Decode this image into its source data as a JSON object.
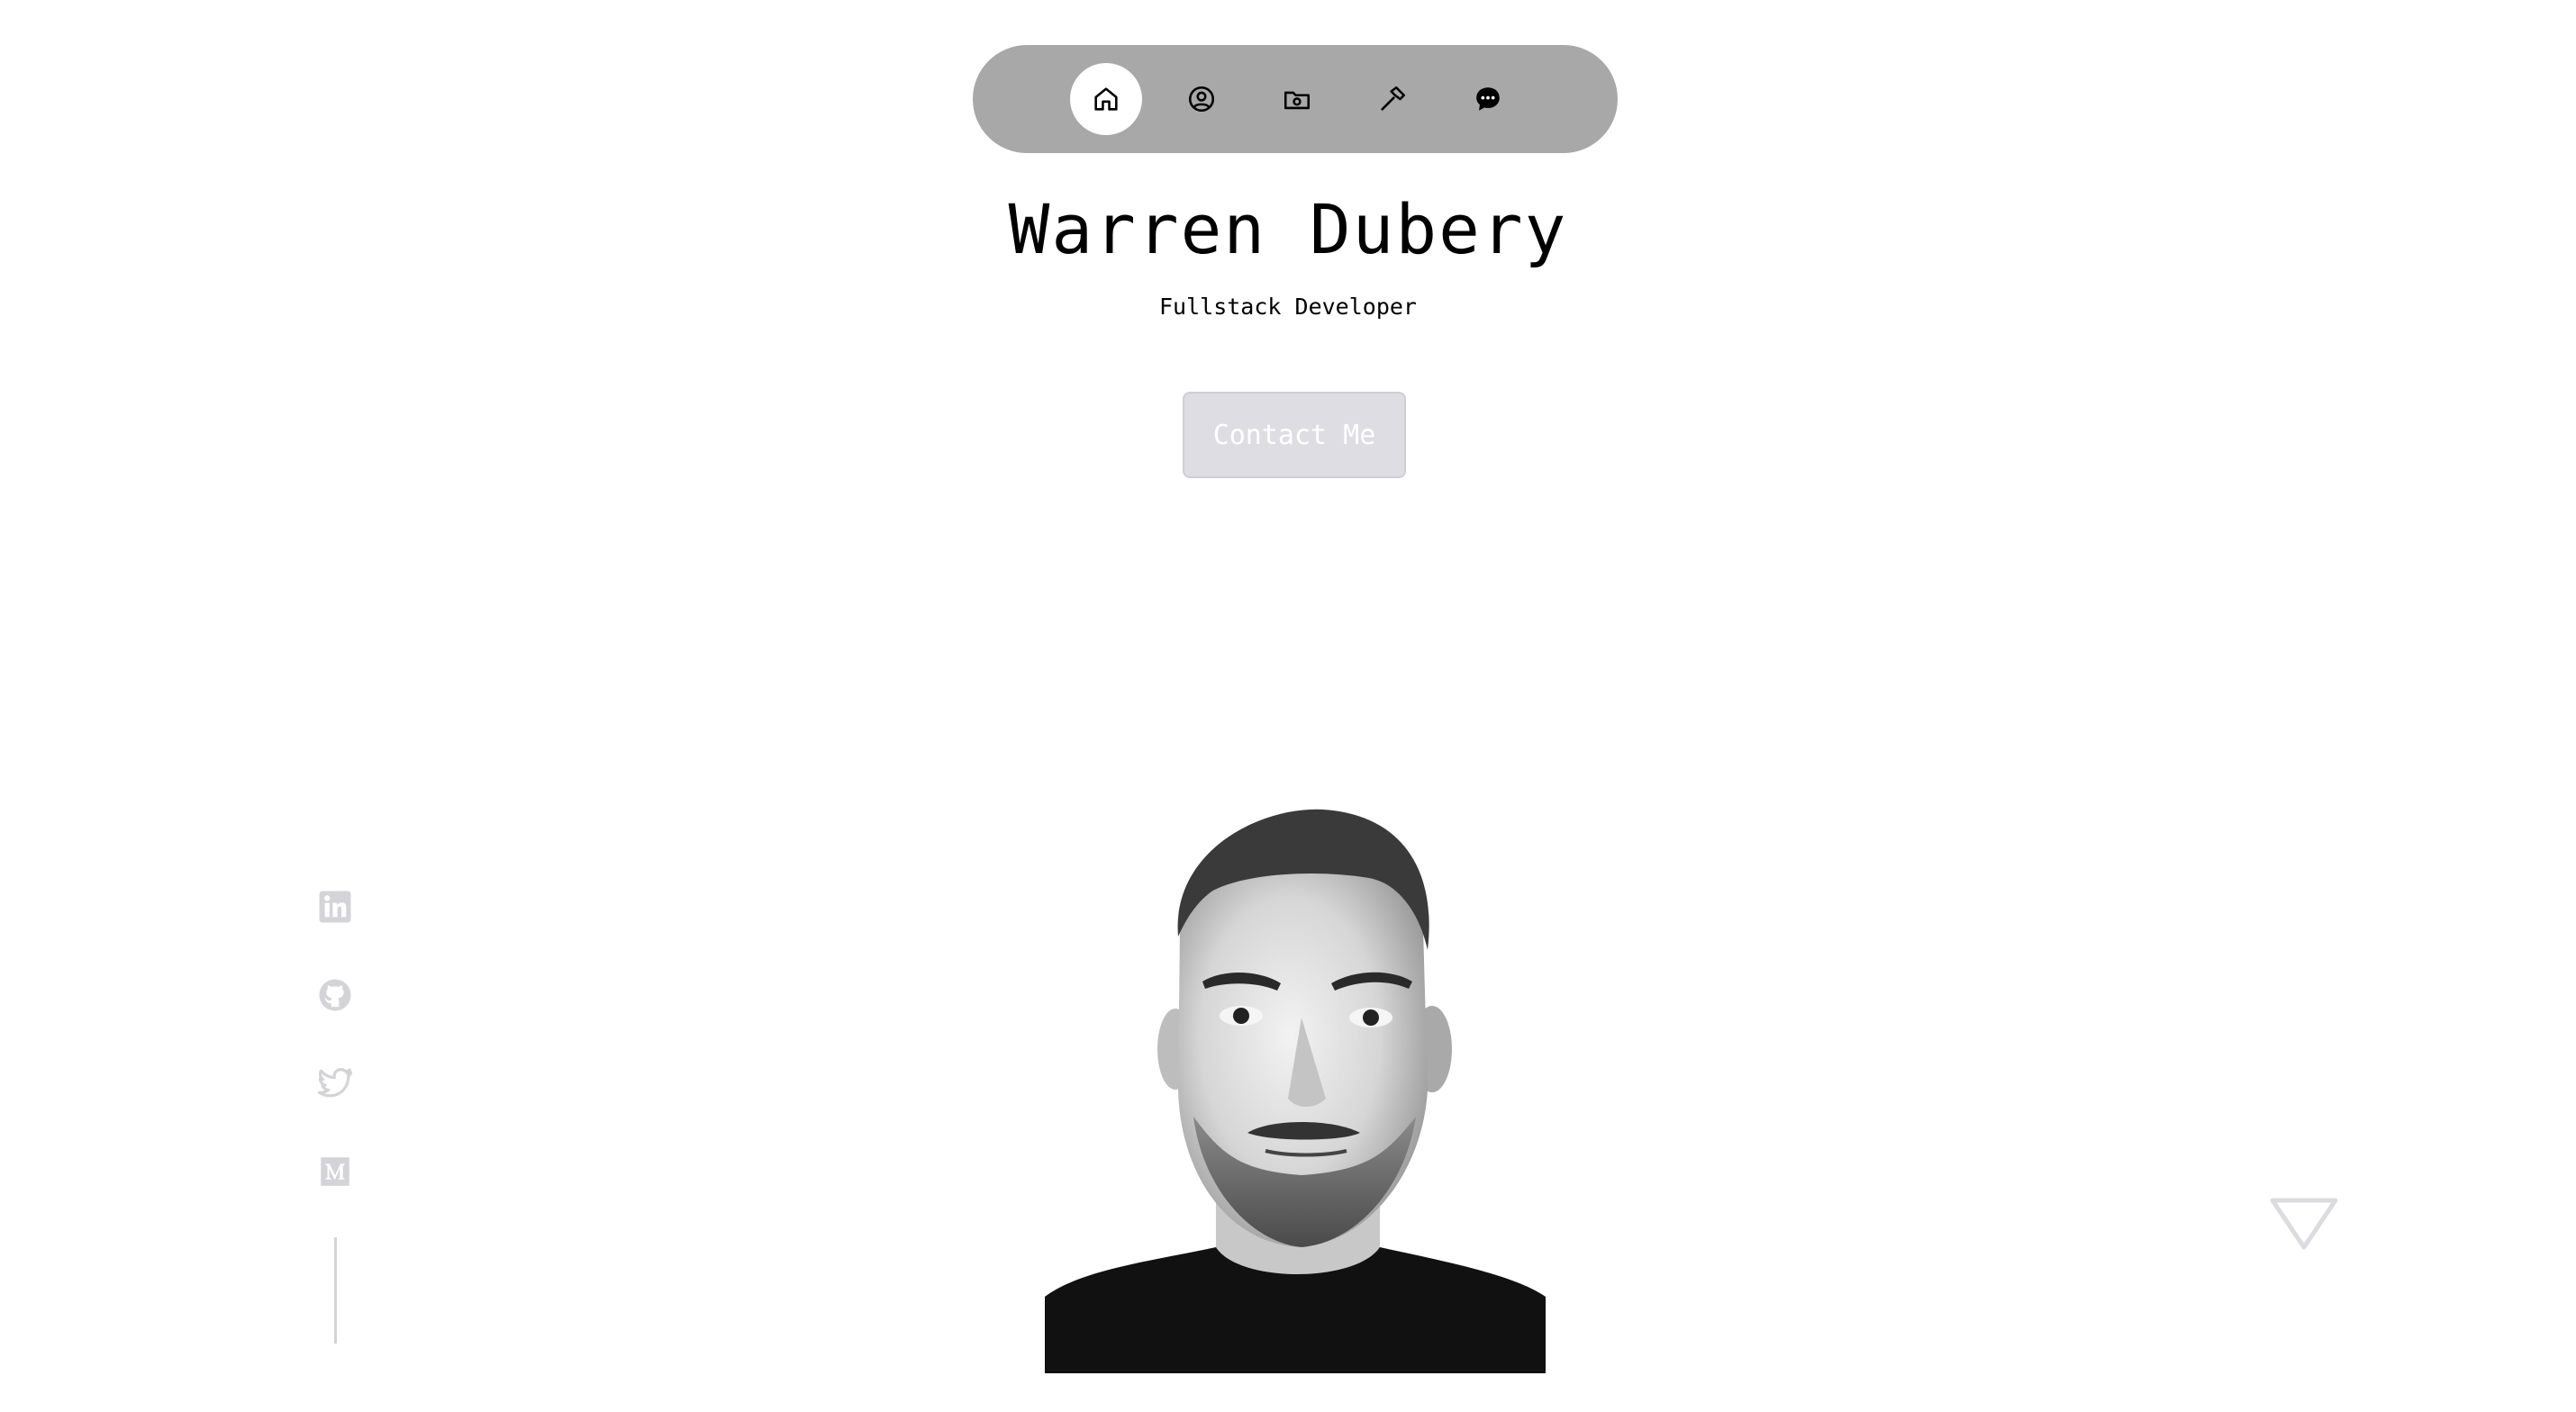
{
  "nav": {
    "items": [
      {
        "icon": "home-icon",
        "active": true
      },
      {
        "icon": "user-circle-icon",
        "active": false
      },
      {
        "icon": "folder-camera-icon",
        "active": false
      },
      {
        "icon": "hammer-icon",
        "active": false
      },
      {
        "icon": "chat-bubble-icon",
        "active": false
      }
    ]
  },
  "hero": {
    "name": "Warren Dubery",
    "role": "Fullstack Developer",
    "contact_label": "Contact Me"
  },
  "socials": [
    {
      "icon": "linkedin-icon"
    },
    {
      "icon": "github-icon"
    },
    {
      "icon": "twitter-icon"
    },
    {
      "icon": "medium-icon"
    }
  ],
  "colors": {
    "nav_bg": "#a8a8a8",
    "active_nav": "#ffffff",
    "button_bg": "#dedde3",
    "social_icons": "#d4d4d8"
  }
}
